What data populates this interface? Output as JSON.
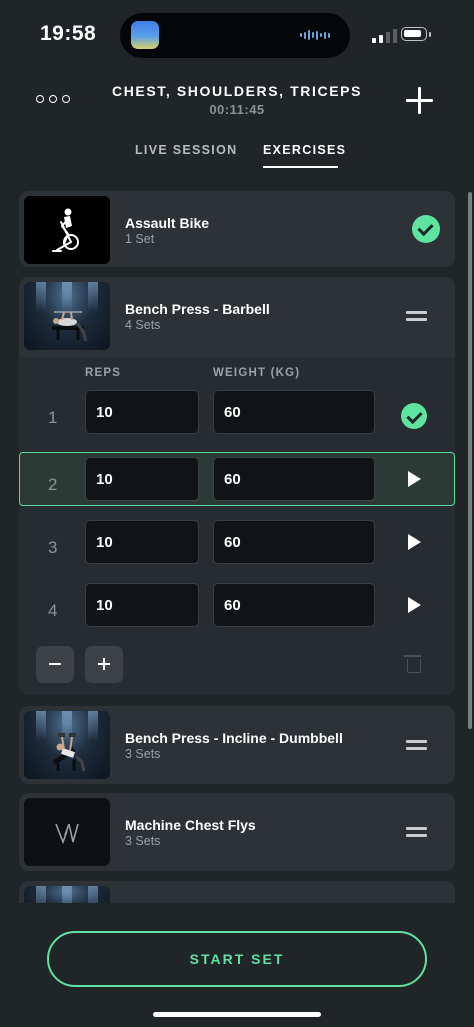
{
  "status_bar": {
    "time": "19:58"
  },
  "header": {
    "title": "CHEST, SHOULDERS, TRICEPS",
    "elapsed": "00:11:45"
  },
  "tabs": [
    {
      "label": "LIVE SESSION",
      "active": false
    },
    {
      "label": "EXERCISES",
      "active": true
    }
  ],
  "exercises": [
    {
      "name": "Assault Bike",
      "sets": "1 Set",
      "status": "completed"
    },
    {
      "name": "Bench Press - Barbell",
      "sets": "4 Sets",
      "status": "expanded",
      "columns": {
        "reps": "REPS",
        "weight": "WEIGHT (KG)"
      },
      "rows": [
        {
          "num": "1",
          "reps": "10",
          "weight": "60",
          "state": "done"
        },
        {
          "num": "2",
          "reps": "10",
          "weight": "60",
          "state": "active"
        },
        {
          "num": "3",
          "reps": "10",
          "weight": "60",
          "state": "pending"
        },
        {
          "num": "4",
          "reps": "10",
          "weight": "60",
          "state": "pending"
        }
      ]
    },
    {
      "name": "Bench Press - Incline - Dumbbell",
      "sets": "3 Sets",
      "status": "pending"
    },
    {
      "name": "Machine Chest Flys",
      "sets": "3 Sets",
      "status": "pending"
    }
  ],
  "footer": {
    "start_label": "START SET"
  },
  "colors": {
    "accent": "#5fe3a1",
    "background": "#202528",
    "card": "#2d3236"
  },
  "icons": [
    "more-icon",
    "add-icon",
    "bike-icon",
    "check-icon",
    "drag-handle-icon",
    "play-icon",
    "trash-icon"
  ]
}
